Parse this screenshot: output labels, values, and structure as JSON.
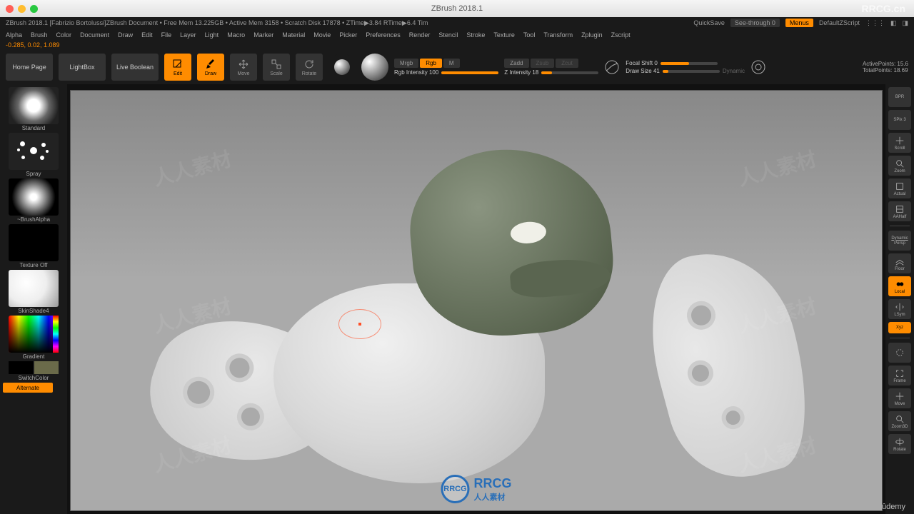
{
  "window": {
    "title": "ZBrush 2018.1"
  },
  "statusBar": {
    "left": "ZBrush 2018.1 [Fabrizio Bortolussi]ZBrush Document    • Free Mem 13.225GB • Active Mem 3158 • Scratch Disk 17878 • ZTime▶3.84 RTime▶6.4 Tim",
    "quicksave": "QuickSave",
    "seeThrough": "See-through  0",
    "menus": "Menus",
    "defaultScript": "DefaultZScript"
  },
  "menus": [
    "Alpha",
    "Brush",
    "Color",
    "Document",
    "Draw",
    "Edit",
    "File",
    "Layer",
    "Light",
    "Macro",
    "Marker",
    "Material",
    "Movie",
    "Picker",
    "Preferences",
    "Render",
    "Stencil",
    "Stroke",
    "Texture",
    "Tool",
    "Transform",
    "Zplugin",
    "Zscript"
  ],
  "coords": "-0.285, 0.02, 1.089",
  "toolbar": {
    "homePage": "Home Page",
    "lightBox": "LightBox",
    "liveBoolean": "Live Boolean",
    "edit": "Edit",
    "draw": "Draw",
    "move": "Move",
    "scale": "Scale",
    "rotate": "Rotate",
    "mrgb": "Mrgb",
    "rgb": "Rgb",
    "m": "M",
    "rgbIntensity": "Rgb Intensity 100",
    "zadd": "Zadd",
    "zsub": "Zsub",
    "zcut": "Zcut",
    "zIntensity": "Z Intensity 18",
    "focalShift": "Focal Shift 0",
    "drawSize": "Draw Size 41",
    "dynamic": "Dynamic",
    "activePoints": "ActivePoints: 15.6",
    "totalPoints": "TotalPoints: 18.69"
  },
  "leftPanel": {
    "brush": "Standard",
    "stroke": "Spray",
    "alpha": "~BrushAlpha",
    "texture": "Texture Off",
    "material": "SkinShade4",
    "gradient": "Gradient",
    "switchColor": "SwitchColor",
    "alternate": "Alternate"
  },
  "rightPanel": {
    "bpr": "BPR",
    "spix": "SPix 3",
    "scroll": "Scroll",
    "zoom": "Zoom",
    "actual": "Actual",
    "aahalf": "AAHalf",
    "persp": "Persp",
    "floor": "Floor",
    "local": "Local",
    "lsym": "LSym",
    "xyz": "Xyz",
    "frame": "Frame",
    "move": "Move",
    "zoom3d": "Zoom3D",
    "rotate": "Rotate"
  },
  "watermarks": {
    "text": "人人素材",
    "topRight": "RRCG.cn",
    "centerLogo": "RRCG",
    "centerSub": "人人素材",
    "bottomRight": "ûdemy"
  }
}
